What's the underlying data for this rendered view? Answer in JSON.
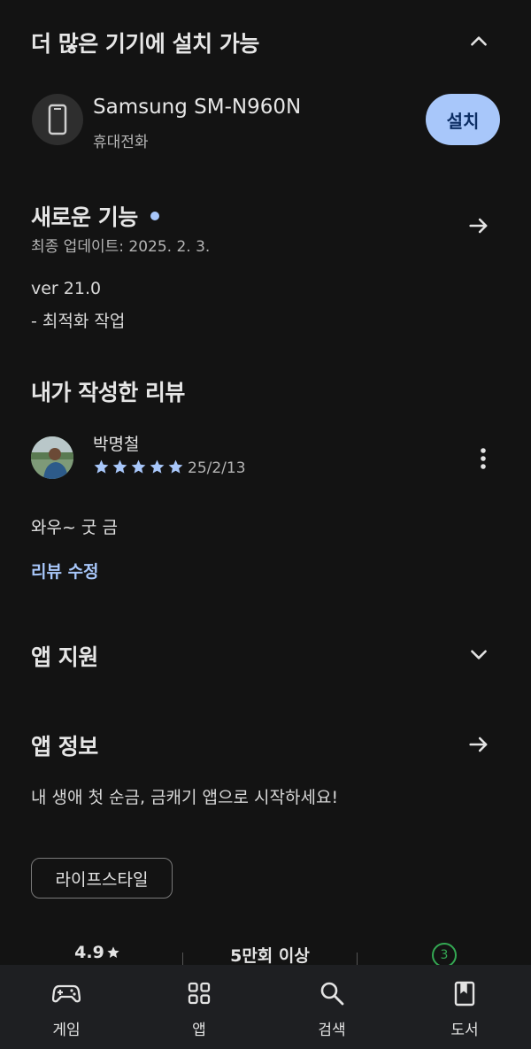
{
  "other_devices": {
    "title": "더 많은 기기에 설치 가능",
    "device_name": "Samsung SM-N960N",
    "device_type": "휴대전화",
    "install_label": "설치"
  },
  "whats_new": {
    "title": "새로운 기능",
    "updated": "최종 업데이트: 2025. 2. 3.",
    "line1": "ver 21.0",
    "line2": "- 최적화 작업"
  },
  "my_review": {
    "title": "내가 작성한 리뷰",
    "author": "박명철",
    "stars": 5,
    "date": "25/2/13",
    "text": "와우~ 굿 금",
    "edit_label": "리뷰 수정"
  },
  "app_support": {
    "title": "앱 지원"
  },
  "app_info": {
    "title": "앱 정보",
    "description": "내 생애 첫 순금, 금캐기 앱으로 시작하세요!",
    "category": "라이프스타일",
    "rating": "4.9",
    "downloads": "5만회 이상",
    "age_rating": "3"
  },
  "bottom_nav": [
    {
      "label": "게임",
      "icon": "gamepad-icon"
    },
    {
      "label": "앱",
      "icon": "apps-grid-icon"
    },
    {
      "label": "검색",
      "icon": "search-icon"
    },
    {
      "label": "도서",
      "icon": "book-icon"
    }
  ],
  "colors": {
    "background": "#131313",
    "accent": "#a8c7fa",
    "nav_bg": "#1e1f22",
    "age_badge": "#34a853"
  }
}
